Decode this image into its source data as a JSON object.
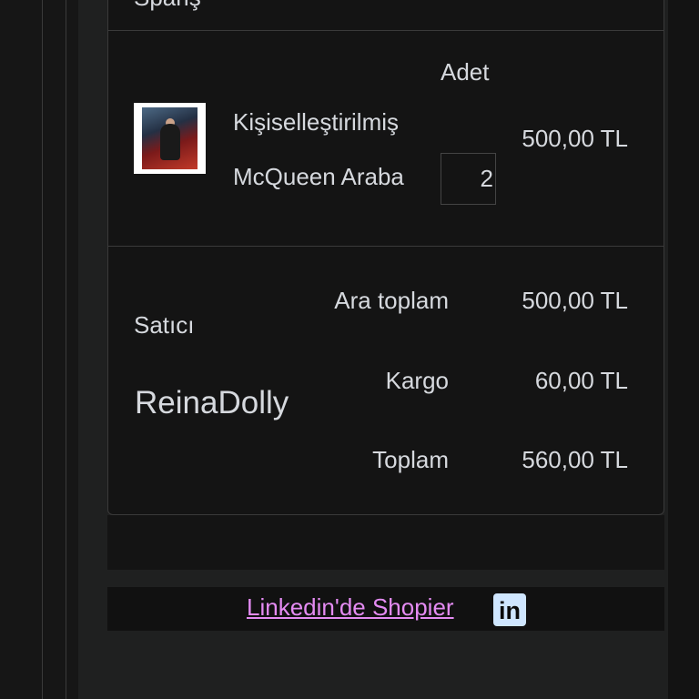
{
  "header_fragment": "Spariş",
  "cart_item": {
    "qty_label": "Adet",
    "name_line1": "Kişiselleştirilmiş",
    "name_line2": "McQueen Araba",
    "qty": "2",
    "price": "500,00 TL"
  },
  "seller": {
    "label": "Satıcı",
    "name": "ReinaDolly"
  },
  "summary": {
    "subtotal_label": "Ara toplam",
    "subtotal_value": "500,00 TL",
    "shipping_label": "Kargo",
    "shipping_value": "60,00 TL",
    "total_label": "Toplam",
    "total_value": "560,00 TL"
  },
  "footer": {
    "link_text": "Linkedin'de Shopier",
    "icon_text": "in",
    "icon": "linkedin-icon",
    "link_color": "#e48bf2"
  }
}
